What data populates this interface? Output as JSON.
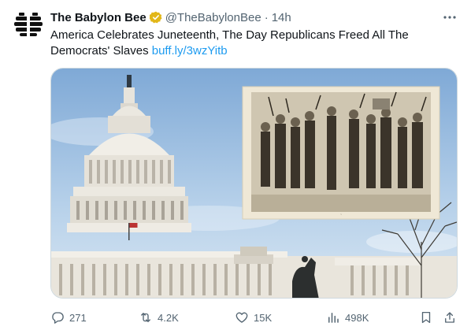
{
  "tweet": {
    "author_name": "The Babylon Bee",
    "handle": "@TheBabylonBee",
    "separator": "·",
    "time": "14h",
    "text": "America Celebrates Juneteenth, The Day Republicans Freed All The Democrats' Slaves",
    "link": "buff.ly/3wzYitb"
  },
  "actions": {
    "replies": "271",
    "reposts": "4.2K",
    "likes": "15K",
    "views": "498K"
  },
  "colors": {
    "link": "#1d9bf0",
    "verified_badge": "#e2b719",
    "secondary_text": "#536471",
    "sky": "#a9c9e6"
  },
  "icons": [
    "babylon-bee-logo-icon",
    "verified-badge-icon",
    "more-options-icon",
    "reply-icon",
    "repost-icon",
    "like-icon",
    "views-icon",
    "bookmark-icon",
    "share-icon"
  ]
}
